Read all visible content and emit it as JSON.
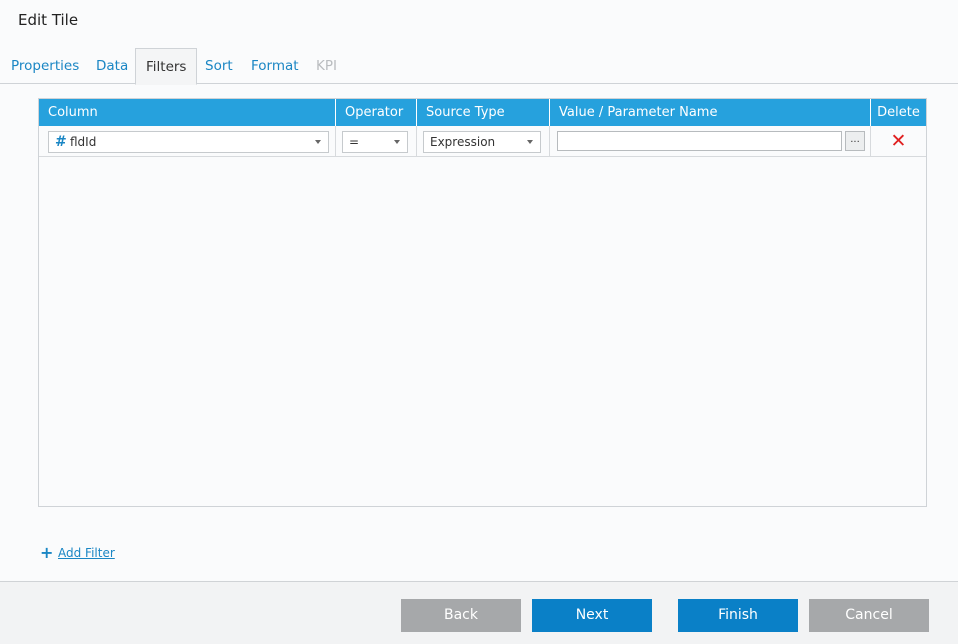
{
  "dialog": {
    "title": "Edit Tile"
  },
  "tabs": [
    {
      "label": "Properties",
      "state": "normal"
    },
    {
      "label": "Data",
      "state": "normal"
    },
    {
      "label": "Filters",
      "state": "active"
    },
    {
      "label": "Sort",
      "state": "normal"
    },
    {
      "label": "Format",
      "state": "normal"
    },
    {
      "label": "KPI",
      "state": "disabled"
    }
  ],
  "grid": {
    "headers": [
      "Column",
      "Operator",
      "Source Type",
      "Value / Parameter Name",
      "Delete"
    ],
    "rows": [
      {
        "column_icon": "hash-icon",
        "column_symbol": "#",
        "column": "fldId",
        "operator": "=",
        "source_type": "Expression",
        "value": "",
        "ellipsis_label": "...",
        "delete_symbol": "✕"
      }
    ]
  },
  "add_filter": {
    "symbol": "+",
    "label": "Add Filter"
  },
  "footer": {
    "back_label": "Back",
    "next_label": "Next",
    "finish_label": "Finish",
    "cancel_label": "Cancel"
  },
  "colors": {
    "accent": "#26a1dd",
    "primary_button": "#0a80c7",
    "secondary_button": "#a6a8aa",
    "link": "#1a86c4",
    "delete": "#e02020"
  }
}
